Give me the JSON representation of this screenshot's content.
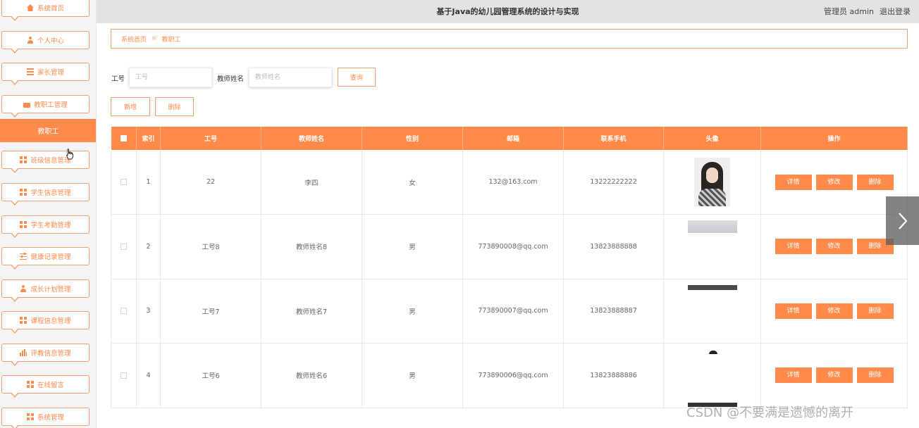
{
  "header": {
    "title": "基于Java的幼儿园管理系统的设计与实现",
    "user": "管理员 admin",
    "logout": "退出登录"
  },
  "sidebar": {
    "items": [
      {
        "label": "系统首页",
        "icon": "home-icon"
      },
      {
        "label": "个人中心",
        "icon": "user-icon"
      },
      {
        "label": "家长管理",
        "icon": "list-icon"
      },
      {
        "label": "教职工管理",
        "icon": "briefcase-icon"
      },
      {
        "label": "班级信息管理",
        "icon": "grid-icon"
      },
      {
        "label": "学生信息管理",
        "icon": "grid-icon"
      },
      {
        "label": "学生考勤管理",
        "icon": "grid-icon"
      },
      {
        "label": "健康记录管理",
        "icon": "slider-icon"
      },
      {
        "label": "成长计划管理",
        "icon": "user-icon"
      },
      {
        "label": "课程信息管理",
        "icon": "grid-icon"
      },
      {
        "label": "评教信息管理",
        "icon": "bar-chart-icon"
      },
      {
        "label": "在线留言",
        "icon": "grid-icon"
      },
      {
        "label": "系统管理",
        "icon": "grid-icon"
      }
    ],
    "active_sub": "教职工"
  },
  "breadcrumb": {
    "home": "系统首页",
    "separator": "≡",
    "current": "教职工"
  },
  "search": {
    "field1_label": "工号",
    "field1_placeholder": "工号",
    "field2_label": "教师姓名",
    "field2_placeholder": "教师姓名",
    "query_button": "查询"
  },
  "toolbar": {
    "add_button": "新增",
    "delete_button": "删除"
  },
  "table": {
    "columns": [
      "索引",
      "工号",
      "教师姓名",
      "性别",
      "邮箱",
      "联系手机",
      "头像",
      "操作"
    ],
    "rows": [
      {
        "index": "1",
        "id": "22",
        "name": "李四",
        "gender": "女",
        "email": "132@163.com",
        "phone": "13222222222"
      },
      {
        "index": "2",
        "id": "工号8",
        "name": "教师姓名8",
        "gender": "男",
        "email": "773890008@qq.com",
        "phone": "13823888888"
      },
      {
        "index": "3",
        "id": "工号7",
        "name": "教师姓名7",
        "gender": "男",
        "email": "773890007@qq.com",
        "phone": "13823888887"
      },
      {
        "index": "4",
        "id": "工号6",
        "name": "教师姓名6",
        "gender": "男",
        "email": "773890006@qq.com",
        "phone": "13823888886"
      }
    ],
    "actions": {
      "detail": "详情",
      "edit": "修改",
      "delete": "删除"
    }
  },
  "watermark": "CSDN @不要满是遗憾的离开",
  "colors": {
    "accent": "#ff8a4a",
    "border": "#f0a070",
    "header_bg": "#e3e3e3"
  }
}
